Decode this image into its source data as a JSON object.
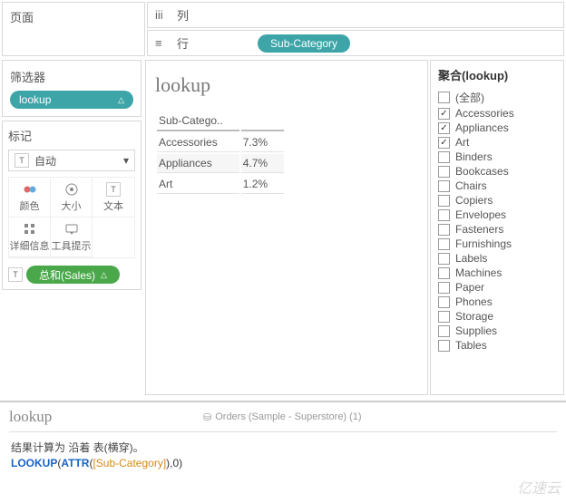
{
  "pages": {
    "title": "页面"
  },
  "shelves": {
    "columns_label": "列",
    "rows_label": "行",
    "row_pill": "Sub-Category"
  },
  "filters": {
    "title": "筛选器",
    "pill": "lookup",
    "pill_icon": "△"
  },
  "marks": {
    "title": "标记",
    "type_prefix": "T",
    "type_label": "自动",
    "cells": {
      "color": "颜色",
      "size": "大小",
      "text": "文本",
      "detail": "详细信息",
      "tooltip": "工具提示"
    },
    "pill_prefix": "T",
    "pill_label": "总和(Sales)",
    "pill_icon": "△"
  },
  "sheet": {
    "title": "lookup",
    "header": "Sub-Catego..",
    "rows": [
      {
        "name": "Accessories",
        "value": "7.3%"
      },
      {
        "name": "Appliances",
        "value": "4.7%"
      },
      {
        "name": "Art",
        "value": "1.2%"
      }
    ]
  },
  "agg_panel": {
    "title": "聚合(lookup)",
    "all_label": "(全部)",
    "items": [
      {
        "label": "Accessories",
        "checked": true
      },
      {
        "label": "Appliances",
        "checked": true
      },
      {
        "label": "Art",
        "checked": true
      },
      {
        "label": "Binders",
        "checked": false
      },
      {
        "label": "Bookcases",
        "checked": false
      },
      {
        "label": "Chairs",
        "checked": false
      },
      {
        "label": "Copiers",
        "checked": false
      },
      {
        "label": "Envelopes",
        "checked": false
      },
      {
        "label": "Fasteners",
        "checked": false
      },
      {
        "label": "Furnishings",
        "checked": false
      },
      {
        "label": "Labels",
        "checked": false
      },
      {
        "label": "Machines",
        "checked": false
      },
      {
        "label": "Paper",
        "checked": false
      },
      {
        "label": "Phones",
        "checked": false
      },
      {
        "label": "Storage",
        "checked": false
      },
      {
        "label": "Supplies",
        "checked": false
      },
      {
        "label": "Tables",
        "checked": false
      }
    ]
  },
  "calc": {
    "name": "lookup",
    "datasource": "Orders (Sample - Superstore) (1)",
    "comment": "结果计算为 沿着 表(横穿)。",
    "fn1": "LOOKUP",
    "paren_open": "(",
    "fn2": "ATTR",
    "paren_open2": "(",
    "field": "[Sub-Category]",
    "tail": "),0)"
  },
  "watermark": "亿速云"
}
